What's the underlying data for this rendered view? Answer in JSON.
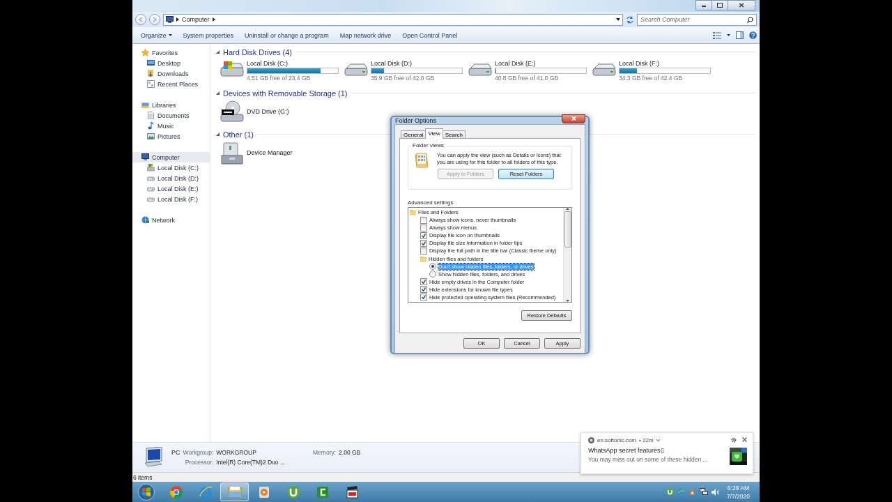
{
  "window": {
    "address_bar": {
      "path": [
        "Computer"
      ],
      "search": {
        "placeholder": "Search Computer"
      }
    },
    "command_bar": [
      {
        "label": "Organize",
        "dropdown": true
      },
      {
        "label": "System properties",
        "dropdown": false
      },
      {
        "label": "Uninstall or change a program",
        "dropdown": false
      },
      {
        "label": "Map network drive",
        "dropdown": false
      },
      {
        "label": "Open Control Panel",
        "dropdown": false
      }
    ],
    "sidebar": [
      {
        "label": "Favorites",
        "kind": "star",
        "selected": false,
        "children": [
          {
            "label": "Desktop",
            "kind": "desktop",
            "selected": false
          },
          {
            "label": "Downloads",
            "kind": "downloads",
            "selected": false
          },
          {
            "label": "Recent Places",
            "kind": "recent",
            "selected": false
          }
        ]
      },
      {
        "label": "Libraries",
        "kind": "library",
        "selected": false,
        "children": [
          {
            "label": "Documents",
            "kind": "document",
            "selected": false
          },
          {
            "label": "Music",
            "kind": "music",
            "selected": false
          },
          {
            "label": "Pictures",
            "kind": "pictures",
            "selected": false
          }
        ]
      },
      {
        "label": "Computer",
        "kind": "computer",
        "selected": true,
        "children": [
          {
            "label": "Local Disk (C:)",
            "kind": "sysdisk",
            "selected": false
          },
          {
            "label": "Local Disk (D:)",
            "kind": "disk",
            "selected": false
          },
          {
            "label": "Local Disk (E:)",
            "kind": "disk",
            "selected": false
          },
          {
            "label": "Local Disk (F:)",
            "kind": "disk",
            "selected": false
          }
        ]
      },
      {
        "label": "Network",
        "kind": "network",
        "selected": false
      }
    ],
    "groups": [
      {
        "title": "Hard Disk Drives (4)",
        "items": [
          {
            "kind": "sysdrive",
            "name": "Local Disk (C:)",
            "level": 0.81,
            "free": "4.51 GB free of 23.4 GB"
          },
          {
            "kind": "drive",
            "name": "Local Disk (D:)",
            "level": 0.14,
            "free": "35.9 GB free of 42.0 GB"
          },
          {
            "kind": "drive",
            "name": "Local Disk (E:)",
            "level": 0.01,
            "free": "40.8 GB free of 41.0 GB"
          },
          {
            "kind": "drive",
            "name": "Local Disk (F:)",
            "level": 0.19,
            "free": "34.3 GB free of 42.4 GB"
          }
        ]
      },
      {
        "title": "Devices with Removable Storage (1)",
        "items": [
          {
            "kind": "dvd",
            "name": "DVD Drive (G:)"
          }
        ]
      },
      {
        "title": "Other (1)",
        "items": [
          {
            "kind": "tool",
            "name": "Device Manager"
          }
        ]
      }
    ],
    "details": {
      "name": "PC",
      "fields": [
        {
          "label": "Workgroup:",
          "value": "WORKGROUP"
        },
        {
          "label": "Memory:",
          "value": "2.00 GB"
        },
        {
          "label": "Processor:",
          "value": "Intel(R) Core(TM)2 Duo ..."
        }
      ]
    },
    "status_bar": "6 items"
  },
  "dialog": {
    "title": "Folder Options",
    "tabs": [
      {
        "label": "General",
        "selected": false
      },
      {
        "label": "View",
        "selected": true
      },
      {
        "label": "Search",
        "selected": false
      }
    ],
    "folder_views": {
      "title": "Folder views",
      "text": "You can apply the view (such as Details or Icons) that you are using for this folder to all folders of this type.",
      "buttons": [
        {
          "label": "Apply to Folders",
          "disabled": true,
          "highlighted": false
        },
        {
          "label": "Reset Folders",
          "disabled": false,
          "highlighted": true
        }
      ]
    },
    "advanced_label": "Advanced settings:",
    "settings": [
      {
        "kind": "folder",
        "label": "Files and Folders",
        "children": [
          {
            "kind": "checkbox",
            "label": "Always show icons, never thumbnails",
            "checked": false
          },
          {
            "kind": "checkbox",
            "label": "Always show menus",
            "checked": false
          },
          {
            "kind": "checkbox",
            "label": "Display file icon on thumbnails",
            "checked": true
          },
          {
            "kind": "checkbox",
            "label": "Display file size information in folder tips",
            "checked": true
          },
          {
            "kind": "checkbox",
            "label": "Display the full path in the title bar (Classic theme only)",
            "checked": false
          },
          {
            "kind": "folder",
            "label": "Hidden files and folders",
            "children": [
              {
                "kind": "radio",
                "label": "Don't show hidden files, folders, or drives",
                "selected": true
              },
              {
                "kind": "radio",
                "label": "Show hidden files, folders, and drives",
                "selected": false
              }
            ]
          },
          {
            "kind": "checkbox",
            "label": "Hide empty drives in the Computer folder",
            "checked": true
          },
          {
            "kind": "checkbox",
            "label": "Hide extensions for known file types",
            "checked": true
          },
          {
            "kind": "checkbox",
            "label": "Hide protected operating system files (Recommended)",
            "checked": true
          }
        ]
      }
    ],
    "restore_button": "Restore Defaults",
    "buttons": [
      "OK",
      "Cancel",
      "Apply"
    ]
  },
  "notification": {
    "source": "en.softonic.com",
    "time": "• 22m",
    "title": "WhatsApp secret features▯",
    "body": "You may miss out on some of these hidden ..."
  },
  "taskbar": {
    "apps": [
      {
        "kind": "chrome",
        "active": false
      },
      {
        "kind": "ie",
        "active": false
      },
      {
        "kind": "explorer",
        "active": true
      },
      {
        "kind": "media",
        "active": false
      },
      {
        "kind": "torrent",
        "active": false
      },
      {
        "kind": "camtasia",
        "active": false
      },
      {
        "kind": "clapper",
        "active": false
      }
    ],
    "time": "6:29 AM",
    "date": "7/7/2020"
  }
}
